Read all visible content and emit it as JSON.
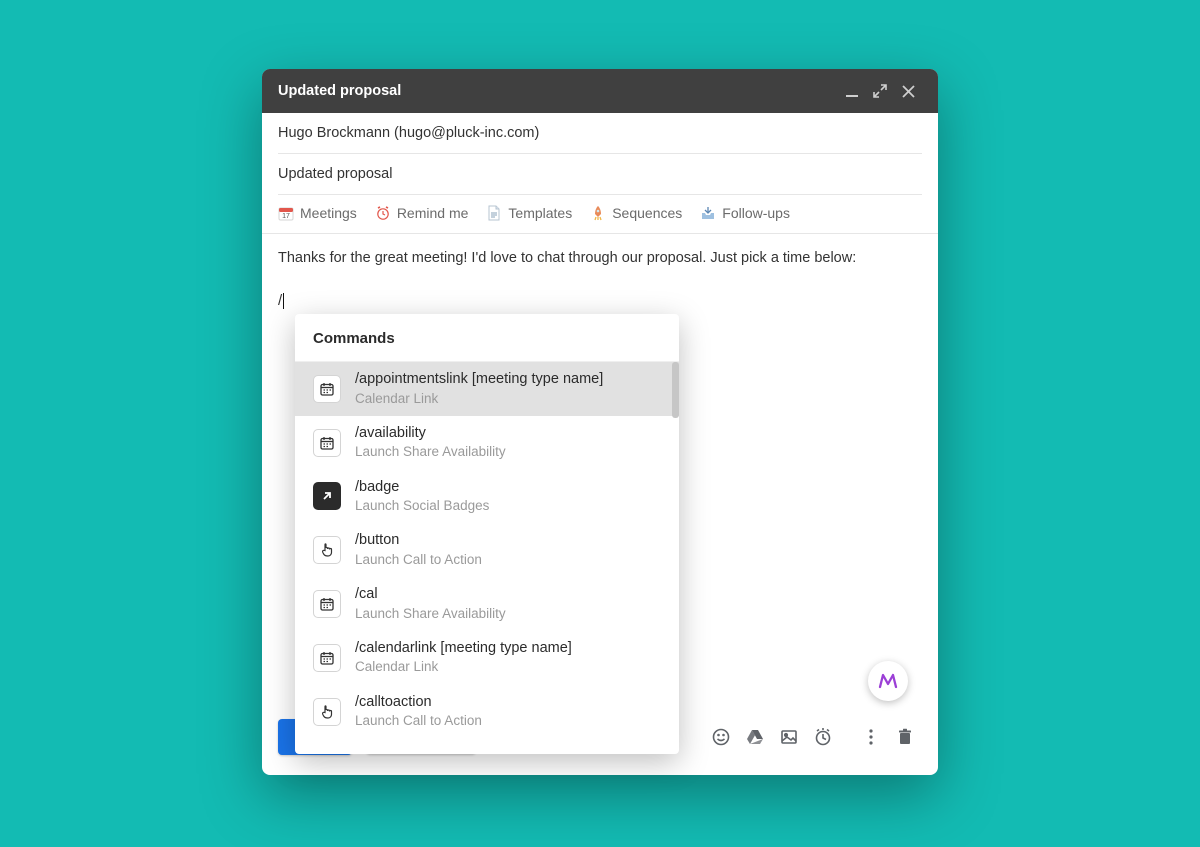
{
  "window": {
    "title": "Updated proposal"
  },
  "fields": {
    "to": "Hugo Brockmann (hugo@pluck-inc.com)",
    "subject": "Updated proposal"
  },
  "toolbar": {
    "meetings": "Meetings",
    "remind": "Remind me",
    "templates": "Templates",
    "sequences": "Sequences",
    "followups": "Follow-ups"
  },
  "body": {
    "line1": "Thanks for the great meeting! I'd love to chat through our proposal. Just pick a time below:",
    "slash": "/"
  },
  "commands": {
    "title": "Commands",
    "items": [
      {
        "name": "/appointmentslink [meeting type name]",
        "desc": "Calendar Link",
        "icon": "calendar",
        "selected": true
      },
      {
        "name": "/availability",
        "desc": "Launch Share Availability",
        "icon": "calendar",
        "selected": false
      },
      {
        "name": "/badge",
        "desc": "Launch Social Badges",
        "icon": "arrow-dark",
        "selected": false
      },
      {
        "name": "/button",
        "desc": "Launch Call to Action",
        "icon": "pointer",
        "selected": false
      },
      {
        "name": "/cal",
        "desc": "Launch Share Availability",
        "icon": "calendar",
        "selected": false
      },
      {
        "name": "/calendarlink [meeting type name]",
        "desc": "Calendar Link",
        "icon": "calendar",
        "selected": false
      },
      {
        "name": "/calltoaction",
        "desc": "Launch Call to Action",
        "icon": "pointer",
        "selected": false
      }
    ]
  }
}
